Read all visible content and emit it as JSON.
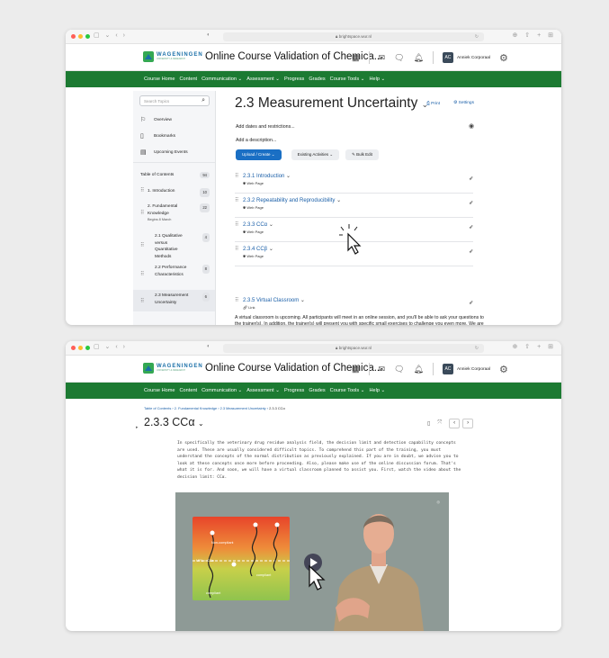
{
  "browser": {
    "url": "brightspace.wur.nl"
  },
  "header": {
    "logo_text": "WAGENINGEN",
    "logo_sub": "UNIVERSITY & RESEARCH",
    "course_title": "Online Course Validation of Chemica...",
    "avatar_initials": "AC",
    "user_name": "Anniek Corporaal"
  },
  "nav": {
    "items": [
      "Course Home",
      "Content",
      "Communication ⌄",
      "Assessment ⌄",
      "Progress",
      "Grades",
      "Course Tools ⌄",
      "Help ⌄"
    ]
  },
  "sidebar": {
    "search_placeholder": "Search Topics",
    "overview": "Overview",
    "bookmarks": "Bookmarks",
    "upcoming": "Upcoming Events",
    "toc_label": "Table of Contents",
    "toc_count": "94",
    "modules": [
      {
        "label": "1. Introduction",
        "count": "10"
      },
      {
        "label": "2. Fundamental Knowledge",
        "sub": "Begins 8 March",
        "count": "22"
      },
      {
        "label": "2.1 Qualitative versus Quantitative Methods",
        "count": "4"
      },
      {
        "label": "2.2 Performance Characteristics",
        "count": "8"
      },
      {
        "label": "2.3 Measurement Uncertainty",
        "count": "6"
      }
    ]
  },
  "module_page": {
    "title": "2.3 Measurement Uncertainty",
    "print": "Print",
    "settings": "Settings",
    "add_dates": "Add dates and restrictions...",
    "add_description": "Add a description...",
    "upload_btn": "Upload / Create",
    "existing_btn": "Existing Activities",
    "bulk_btn": "Bulk Edit",
    "topics": [
      {
        "title": "2.3.1 Introduction",
        "type": "Web Page"
      },
      {
        "title": "2.3.2 Repeatability and Reproducibility",
        "type": "Web Page"
      },
      {
        "title": "2.3.3 CCα",
        "type": "Web Page"
      },
      {
        "title": "2.3.4 CCβ",
        "type": "Web Page"
      },
      {
        "title": "2.3.5 Virtual Classroom",
        "type": "Link"
      }
    ],
    "virtual_desc": "A virtual classroom is upcoming. All participants will meet in an online session, and you'll be able to ask your questions to the trainer(s). In addition, the trainer(s) will present you with specific small exercises to challenge you even more. We are looking forward to seeing you there. And again, don't forget to make use of the discussion forum."
  },
  "topic_page": {
    "crumb1": "Table of Contents",
    "crumb2": "2. Fundamental Knowledge",
    "crumb3": "2.3 Measurement Uncertainty",
    "crumb4": "2.3.3 CCα",
    "title": "2.3.3 CCα",
    "body": "In specifically the veterinary drug residue analysis field, the decision limit and detection capability concepts are used. These are usually considered difficult topics. To comprehend this part of the training, you must understand the concepts of the normal distribution as previously explained. If you are in doubt, we advise you to look at these concepts once more before proceeding. Also, please make use of the online discussion forum. That's what it is for. And soon, we will have a virtual classroom planned to assist you. First, watch the video about the decision limit: CCα.",
    "video_labels": {
      "non_compliant": "Non-compliant",
      "compliant": "compliant",
      "compliant2": "compliant",
      "mrl": "MRL = CCα"
    }
  }
}
